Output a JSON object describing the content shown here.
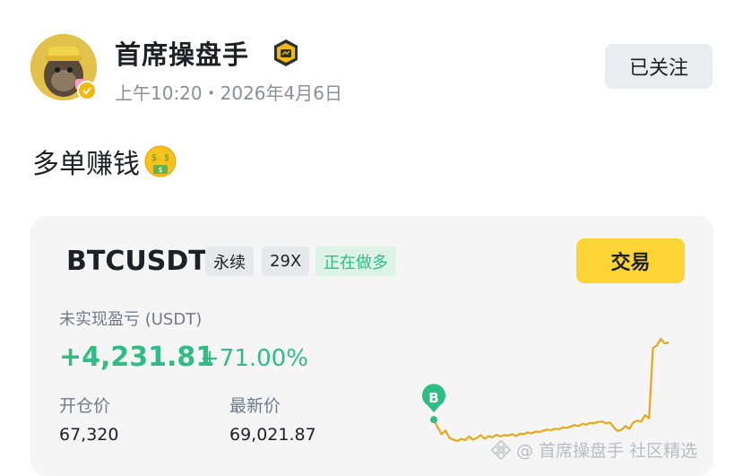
{
  "post": {
    "author": "首席操盘手",
    "timestamp": "上午10:20・2026年4月6日",
    "follow_label": "已关注",
    "text": "多单赚钱",
    "emoji": "money-mouth-face"
  },
  "position_card": {
    "symbol": "BTCUSDT",
    "contract_type": "永续",
    "leverage": "29X",
    "side_status": "正在做多",
    "trade_button": "交易",
    "pnl_label": "未实现盈亏 (USDT)",
    "pnl_value": "+4,231.81",
    "pnl_percent": "+71.00%",
    "open_price_label": "开仓价",
    "open_price": "67,320",
    "last_price_label": "最新价",
    "last_price": "69,021.87",
    "buy_marker": "B"
  },
  "chart_data": {
    "type": "line",
    "x": [
      0,
      1,
      2,
      3,
      4,
      5,
      6,
      7,
      8,
      9,
      10,
      11,
      12,
      13,
      14,
      15,
      16,
      17,
      18,
      19,
      20,
      21,
      22,
      23,
      24,
      25,
      26,
      27,
      28,
      29,
      30,
      31,
      32,
      33,
      34,
      35,
      36,
      37,
      38,
      39,
      40,
      41,
      42,
      43,
      44,
      45,
      46,
      47,
      48,
      49,
      50,
      51,
      52,
      53,
      54,
      55,
      56,
      57,
      58,
      59,
      60
    ],
    "values": [
      67320,
      67150,
      67000,
      67080,
      66920,
      66880,
      66850,
      66900,
      66870,
      66950,
      66880,
      66920,
      66980,
      66900,
      66960,
      66930,
      66990,
      66950,
      66980,
      66970,
      67000,
      66960,
      67010,
      67000,
      67040,
      67020,
      67060,
      67050,
      67080,
      67100,
      67090,
      67120,
      67110,
      67150,
      67140,
      67170,
      67200,
      67180,
      67230,
      67210,
      67250,
      67240,
      67270,
      67280,
      67240,
      67260,
      67150,
      67070,
      67100,
      67180,
      67120,
      67260,
      67300,
      67280,
      67420,
      67350,
      68900,
      68950,
      69100,
      69000,
      69021.87
    ],
    "series": [
      {
        "values_ref": "values",
        "color": "#e6a817"
      }
    ],
    "markers": [
      {
        "x": 0,
        "label": "B",
        "color": "#2ebd85"
      }
    ],
    "grid": false,
    "colors": {
      "line": "#e6a817",
      "marker": "#2ebd85"
    }
  },
  "watermark": "@ 首席操盘手 社区精选"
}
